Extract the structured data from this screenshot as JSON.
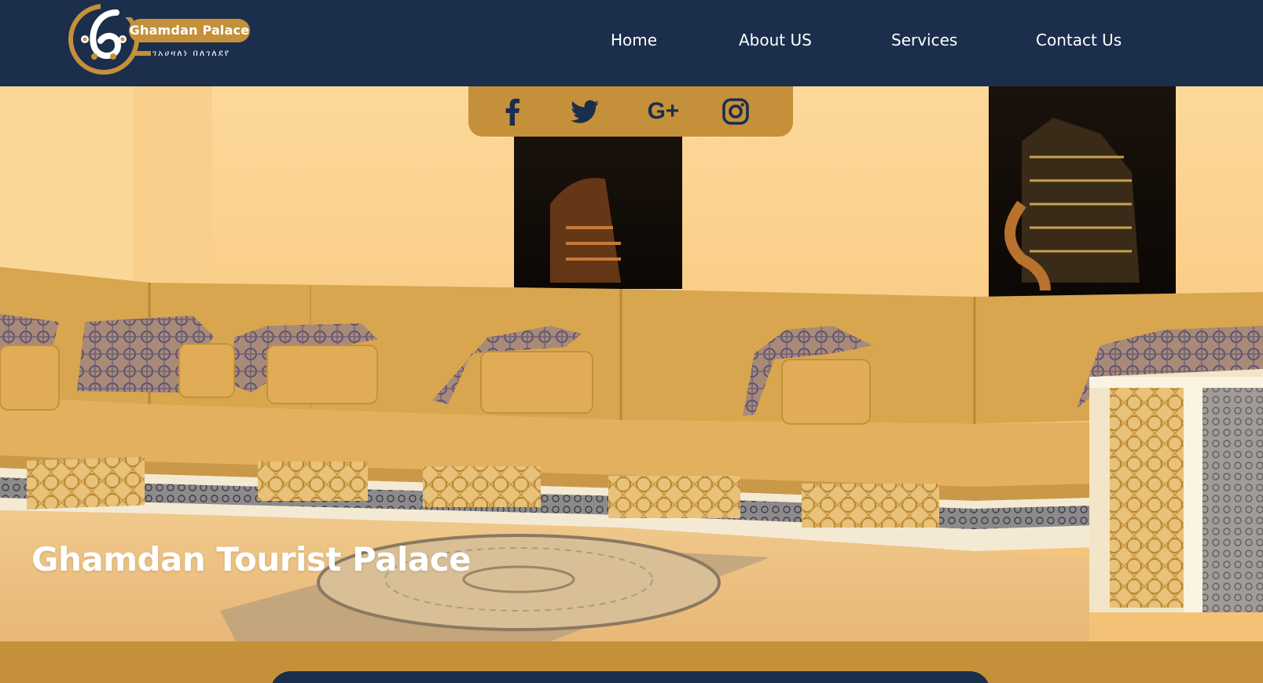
{
  "brand": {
    "name": "Ghamdan Palace",
    "subtitle": "ገአሀዛለነ በለገለደየ"
  },
  "nav": {
    "items": [
      {
        "label": "Home"
      },
      {
        "label": "About US"
      },
      {
        "label": "Services"
      },
      {
        "label": "Contact Us"
      }
    ]
  },
  "social": {
    "icons": [
      "facebook-icon",
      "twitter-icon",
      "google-plus-icon",
      "instagram-icon"
    ],
    "google_plus_label": "G+"
  },
  "hero": {
    "title": "Ghamdan Tourist Palace"
  },
  "colors": {
    "header_bg": "#1b2e4b",
    "accent": "#c4913a",
    "wall": "#fbd592",
    "text_light": "#ffffff"
  }
}
